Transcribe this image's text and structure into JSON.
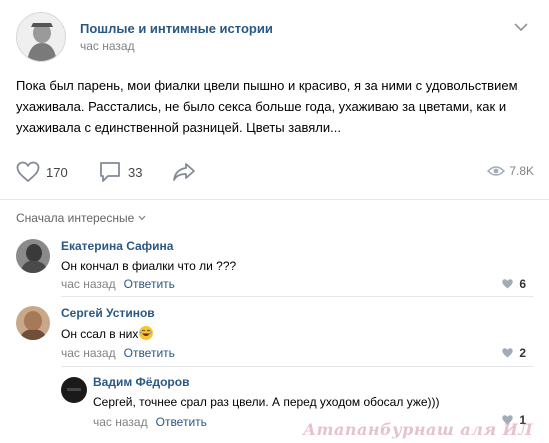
{
  "post": {
    "group_name": "Пошлые и интимные истории",
    "time": "час назад",
    "text": "Пока был парень, мои фиалки цвели пышно и красиво, я за ними с удовольствием ухаживала. Расстались, не было секса больше года, ухаживаю за цветами, как и ухаживала с единственной разницей. Цветы завяли...",
    "likes": "170",
    "comments": "33",
    "views": "7.8K"
  },
  "comments_section": {
    "sort_label": "Сначала интересные",
    "items": [
      {
        "author": "Екатерина Сафина",
        "text": "Он кончал в фиалки что ли ???",
        "time": "час назад",
        "reply": "Ответить",
        "likes": "6"
      },
      {
        "author": "Сергей Устинов",
        "text": "Он ссал в них",
        "time": "час назад",
        "reply": "Ответить",
        "likes": "2"
      },
      {
        "author": "Вадим Фёдоров",
        "text": "Сергей, точнее срал раз цвели. А перед уходом обосал уже)))",
        "time": "час назад",
        "reply": "Ответить",
        "likes": "1"
      }
    ]
  },
  "watermark": "Атапанбурнаш аля ИЛ",
  "colors": {
    "link": "#2a5885",
    "muted": "#828282",
    "divider": "#e7e8ec"
  },
  "icons": {
    "like": "heart-icon",
    "comment": "comment-bubble-icon",
    "share": "share-arrow-icon",
    "views": "eye-icon",
    "more": "chevron-down-icon"
  }
}
